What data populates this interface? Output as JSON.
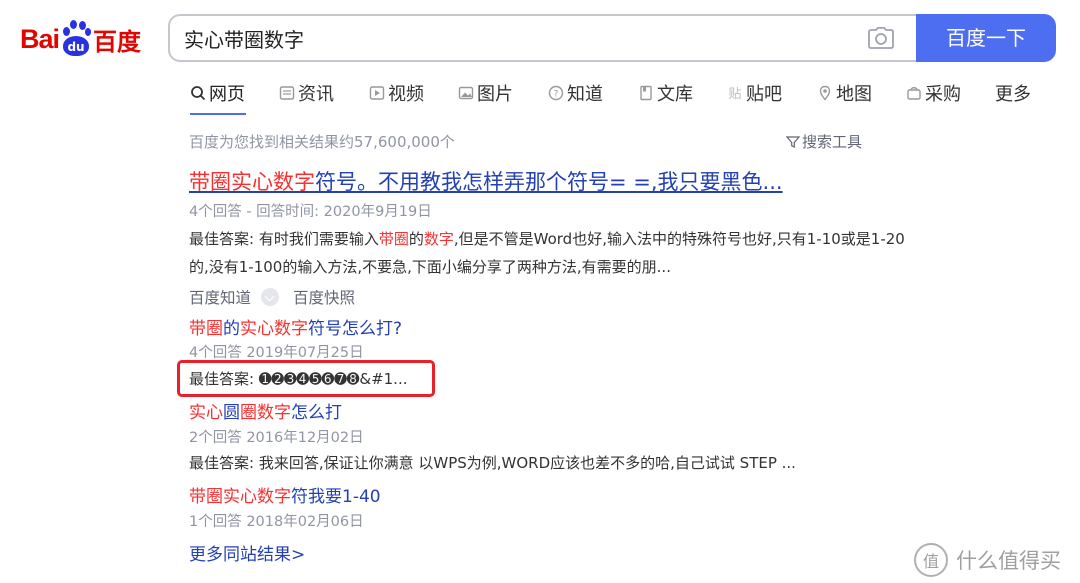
{
  "logo": {
    "part1": "Bai",
    "paw_mark": "du",
    "part2": "百度"
  },
  "search": {
    "query": "实心带圈数字",
    "button_label": "百度一下",
    "camera_icon": "camera-icon"
  },
  "tabs": [
    {
      "label": "网页",
      "icon": "search-icon"
    },
    {
      "label": "资讯",
      "icon": "news-icon"
    },
    {
      "label": "视频",
      "icon": "video-icon"
    },
    {
      "label": "图片",
      "icon": "image-icon"
    },
    {
      "label": "知道",
      "icon": "question-icon"
    },
    {
      "label": "文库",
      "icon": "document-icon"
    },
    {
      "label": "贴吧",
      "icon": "tieba-icon"
    },
    {
      "label": "地图",
      "icon": "map-icon"
    },
    {
      "label": "采购",
      "icon": "shopping-icon"
    },
    {
      "label": "更多",
      "icon": ""
    }
  ],
  "result_count": "百度为您找到相关结果约57,600,000个",
  "search_tools": "搜索工具",
  "main_result": {
    "title_hl": "带圈实心数字",
    "title_rest": "符号。不用教我怎样弄那个符号= =,我只要黑色...",
    "meta": "4个回答 - 回答时间: 2020年9月19日",
    "abstract_1": "最佳答案: 有时我们需要输入",
    "abstract_hl_1": "带圈",
    "abstract_2": "的",
    "abstract_hl_2": "数字",
    "abstract_3": ",但是不管是Word也好,输入法中的特殊符号也好,只有1-10或是1-20的,没有1-100的输入方法,不要急,下面小编分享了两种方法,有需要的朋...",
    "source": "百度知道",
    "snapshot": "百度快照"
  },
  "sub_results": [
    {
      "title_parts": [
        {
          "text": "带圈",
          "hl": true
        },
        {
          "text": "的",
          "hl": false
        },
        {
          "text": "实心数字",
          "hl": true
        },
        {
          "text": "符号怎么打?",
          "hl": false
        }
      ],
      "meta": "4个回答   2019年07月25日",
      "answer": "最佳答案: ➊➋➌➍➎➏➐➑&#1..."
    },
    {
      "title_parts": [
        {
          "text": "实心",
          "hl": true
        },
        {
          "text": "圆",
          "hl": false
        },
        {
          "text": "圈数字",
          "hl": true
        },
        {
          "text": "怎么打",
          "hl": false
        }
      ],
      "meta": "2个回答   2016年12月02日",
      "answer": "最佳答案: 我来回答,保证让你满意 以WPS为例,WORD应该也差不多的哈,自己试试 STEP ..."
    },
    {
      "title_parts": [
        {
          "text": "带圈实心数字",
          "hl": true
        },
        {
          "text": "符我要1-40",
          "hl": false
        }
      ],
      "meta": "1个回答   2018年02月06日",
      "answer": ""
    }
  ],
  "more_link": "更多同站结果>",
  "watermark": {
    "mark": "值",
    "text": "什么值得买"
  },
  "colors": {
    "accent": "#4e6ef2",
    "link": "#2440b3",
    "highlight": "#f73131",
    "annotation": "#e8212a"
  }
}
